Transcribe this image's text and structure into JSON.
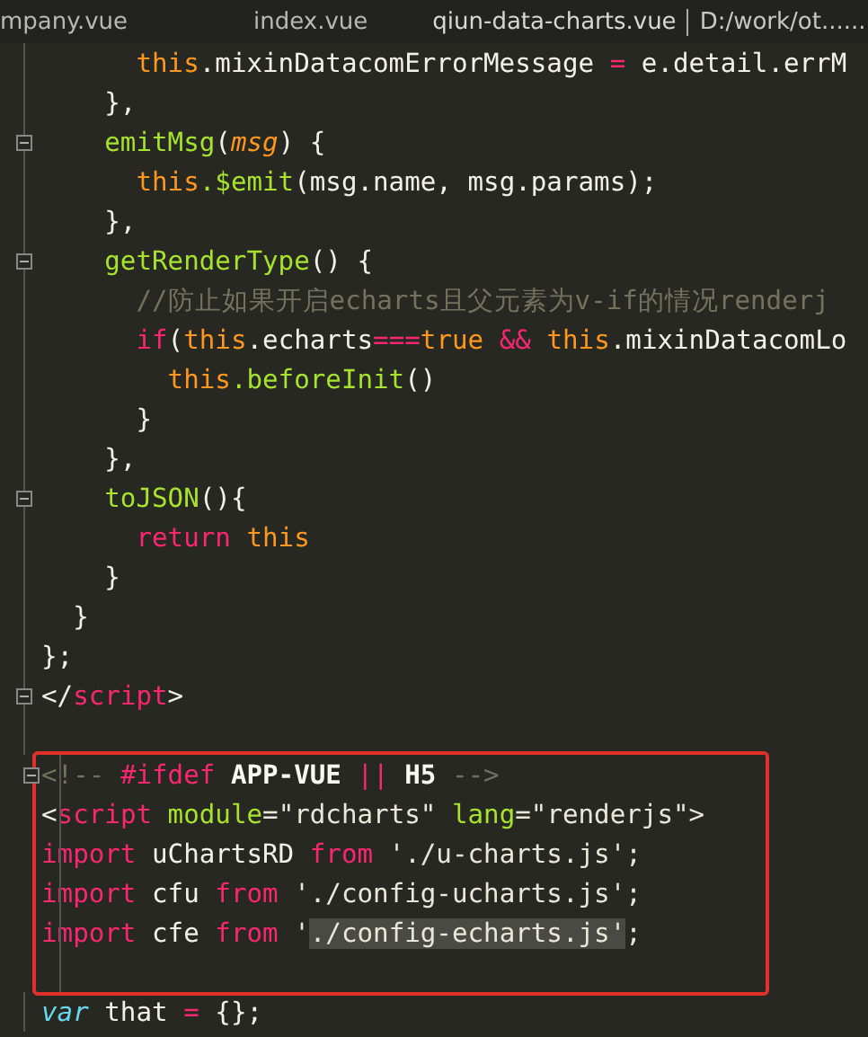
{
  "tabs": [
    {
      "label": "mpany.vue",
      "selected": false
    },
    {
      "label": "index.vue",
      "selected": false
    },
    {
      "label": "qiun-data-charts.vue",
      "path": "D:/work/ot......",
      "selected": true
    }
  ],
  "lines": [
    {
      "foldable": false,
      "boxed": false,
      "tokens": [
        {
          "text": "      this",
          "kind": "this"
        },
        {
          "text": ".mixinDatacomErrorMessage ",
          "kind": "plain"
        },
        {
          "text": "=",
          "kind": "keyword"
        },
        {
          "text": " e.detail.errM",
          "kind": "plain"
        }
      ]
    },
    {
      "foldable": false,
      "boxed": false,
      "tokens": [
        {
          "text": "    },",
          "kind": "plain"
        }
      ]
    },
    {
      "foldable": true,
      "boxed": false,
      "tokens": [
        {
          "text": "    emitMsg",
          "kind": "func"
        },
        {
          "text": "(",
          "kind": "plain"
        },
        {
          "text": "msg",
          "kind": "param"
        },
        {
          "text": ") {",
          "kind": "plain"
        }
      ]
    },
    {
      "foldable": false,
      "boxed": false,
      "tokens": [
        {
          "text": "      this",
          "kind": "this"
        },
        {
          "text": ".$emit",
          "kind": "func"
        },
        {
          "text": "(msg.name, msg.params);",
          "kind": "plain"
        }
      ]
    },
    {
      "foldable": false,
      "boxed": false,
      "tokens": [
        {
          "text": "    },",
          "kind": "plain"
        }
      ]
    },
    {
      "foldable": true,
      "boxed": false,
      "tokens": [
        {
          "text": "    getRenderType",
          "kind": "func"
        },
        {
          "text": "() {",
          "kind": "plain"
        }
      ]
    },
    {
      "foldable": false,
      "boxed": false,
      "tokens": [
        {
          "text": "      //防止如果开启echarts且父元素为v-if的情况renderj",
          "kind": "comment"
        }
      ]
    },
    {
      "foldable": false,
      "boxed": false,
      "tokens": [
        {
          "text": "      if",
          "kind": "keyword"
        },
        {
          "text": "(",
          "kind": "plain"
        },
        {
          "text": "this",
          "kind": "this"
        },
        {
          "text": ".echarts",
          "kind": "plain"
        },
        {
          "text": "===",
          "kind": "keyword"
        },
        {
          "text": "true",
          "kind": "this"
        },
        {
          "text": " && ",
          "kind": "keyword"
        },
        {
          "text": "this",
          "kind": "this"
        },
        {
          "text": ".mixinDatacomLo",
          "kind": "plain"
        }
      ]
    },
    {
      "foldable": false,
      "boxed": false,
      "tokens": [
        {
          "text": "        this",
          "kind": "this"
        },
        {
          "text": ".beforeInit",
          "kind": "func"
        },
        {
          "text": "()",
          "kind": "plain"
        }
      ]
    },
    {
      "foldable": false,
      "boxed": false,
      "tokens": [
        {
          "text": "      }",
          "kind": "plain"
        }
      ]
    },
    {
      "foldable": false,
      "boxed": false,
      "tokens": [
        {
          "text": "    },",
          "kind": "plain"
        }
      ]
    },
    {
      "foldable": true,
      "boxed": false,
      "tokens": [
        {
          "text": "    toJSON",
          "kind": "func"
        },
        {
          "text": "(){",
          "kind": "plain"
        }
      ]
    },
    {
      "foldable": false,
      "boxed": false,
      "tokens": [
        {
          "text": "      return",
          "kind": "keyword"
        },
        {
          "text": " this",
          "kind": "this"
        }
      ]
    },
    {
      "foldable": false,
      "boxed": false,
      "tokens": [
        {
          "text": "    }",
          "kind": "plain"
        }
      ]
    },
    {
      "foldable": false,
      "boxed": false,
      "tokens": [
        {
          "text": "  }",
          "kind": "plain"
        }
      ]
    },
    {
      "foldable": false,
      "boxed": false,
      "tokens": [
        {
          "text": "};",
          "kind": "plain"
        }
      ]
    },
    {
      "foldable": true,
      "boxed": false,
      "tokens": [
        {
          "text": "</",
          "kind": "plain"
        },
        {
          "text": "script",
          "kind": "keyword"
        },
        {
          "text": ">",
          "kind": "plain"
        }
      ]
    },
    {
      "foldable": false,
      "boxed": false
    },
    {
      "foldable": true,
      "boxed": true,
      "tokens": [
        {
          "text": "<!-- ",
          "kind": "comment"
        },
        {
          "text": "#ifdef",
          "kind": "keyword"
        },
        {
          "text": " APP-VUE ",
          "kind": "bold"
        },
        {
          "text": "||",
          "kind": "keyword"
        },
        {
          "text": " H5 ",
          "kind": "bold"
        },
        {
          "text": "-->",
          "kind": "comment"
        }
      ]
    },
    {
      "foldable": false,
      "boxed": true,
      "tokens": [
        {
          "text": "<",
          "kind": "plain"
        },
        {
          "text": "script",
          "kind": "keyword"
        },
        {
          "text": " module",
          "kind": "func"
        },
        {
          "text": "=\"rdcharts\" ",
          "kind": "string"
        },
        {
          "text": "lang",
          "kind": "func"
        },
        {
          "text": "=\"renderjs\">",
          "kind": "string"
        }
      ]
    },
    {
      "foldable": false,
      "boxed": true,
      "tokens": [
        {
          "text": "import",
          "kind": "keyword"
        },
        {
          "text": " uChartsRD ",
          "kind": "plain"
        },
        {
          "text": "from",
          "kind": "keyword"
        },
        {
          "text": " './u-charts.js';",
          "kind": "string"
        }
      ]
    },
    {
      "foldable": false,
      "boxed": true,
      "tokens": [
        {
          "text": "import",
          "kind": "keyword"
        },
        {
          "text": " cfu ",
          "kind": "plain"
        },
        {
          "text": "from",
          "kind": "keyword"
        },
        {
          "text": " './config-ucharts.js';",
          "kind": "string"
        }
      ]
    },
    {
      "foldable": false,
      "boxed": true,
      "tokens": [
        {
          "text": "import",
          "kind": "keyword"
        },
        {
          "text": " cfe ",
          "kind": "plain"
        },
        {
          "text": "from",
          "kind": "keyword"
        },
        {
          "text": " '",
          "kind": "string"
        },
        {
          "text": "./config-echarts.js'",
          "kind": "selection"
        },
        {
          "text": ";",
          "kind": "string"
        }
      ]
    },
    {
      "foldable": false,
      "boxed": true
    },
    {
      "foldable": false,
      "boxed": false,
      "tokens": [
        {
          "text": "var",
          "kind": "storage"
        },
        {
          "text": " that ",
          "kind": "plain"
        },
        {
          "text": "=",
          "kind": "keyword"
        },
        {
          "text": " {};",
          "kind": "plain"
        }
      ]
    }
  ]
}
